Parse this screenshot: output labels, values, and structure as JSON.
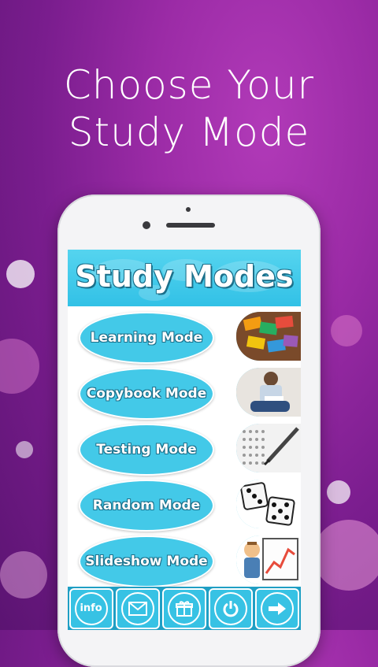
{
  "headline": {
    "line1": "Choose Your",
    "line2": "Study Mode"
  },
  "app": {
    "title": "Study Modes",
    "modes": [
      {
        "label": "Learning Mode",
        "image": "flashcards-image"
      },
      {
        "label": "Copybook Mode",
        "image": "student-writing-image"
      },
      {
        "label": "Testing Mode",
        "image": "answer-sheet-image"
      },
      {
        "label": "Random Mode",
        "image": "dice-image"
      },
      {
        "label": "Slideshow Mode",
        "image": "presenter-chart-image"
      }
    ],
    "bottom_bar": [
      {
        "name": "info-button",
        "label": "info",
        "icon": "info-icon"
      },
      {
        "name": "mail-button",
        "icon": "mail-icon"
      },
      {
        "name": "gift-button",
        "icon": "gift-icon"
      },
      {
        "name": "power-button",
        "icon": "power-icon"
      },
      {
        "name": "next-button",
        "icon": "arrow-right-icon"
      }
    ]
  },
  "colors": {
    "background": "#9b2ba6",
    "accent": "#43c9e8",
    "bar": "#1f9fc4"
  }
}
